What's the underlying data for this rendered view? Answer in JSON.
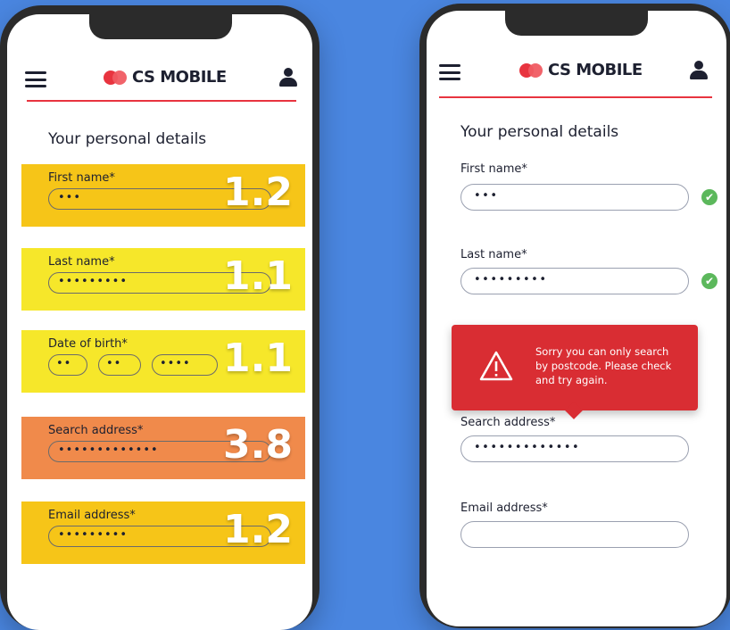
{
  "brand": {
    "name": "CS MOBILE"
  },
  "left_phone": {
    "section_title": "Your personal details",
    "fields": [
      {
        "label": "First name*",
        "masked": [
          "•••"
        ],
        "score": "1.2",
        "band_color": "#f6c518"
      },
      {
        "label": "Last name*",
        "masked": [
          "•••••••••"
        ],
        "score": "1.1",
        "band_color": "#f6e72a"
      },
      {
        "label": "Date of birth*",
        "masked": [
          "••",
          "••",
          "••••"
        ],
        "score": "1.1",
        "band_color": "#f6e72a"
      },
      {
        "label": "Search address*",
        "masked": [
          "•••••••••••••"
        ],
        "score": "3.8",
        "band_color": "#f08a4b"
      },
      {
        "label": "Email address*",
        "masked": [
          "•••••••••"
        ],
        "score": "1.2",
        "band_color": "#f6c518"
      }
    ]
  },
  "right_phone": {
    "section_title": "Your personal details",
    "fields": [
      {
        "label": "First name*",
        "value": "•••",
        "valid": true
      },
      {
        "label": "Last name*",
        "value": "•••••••••",
        "valid": true
      },
      {
        "label": "Search address*",
        "value": "•••••••••••••",
        "valid": false
      },
      {
        "label": "Email address*",
        "value": "",
        "valid": false
      }
    ],
    "error_tooltip": {
      "line1": "Sorry you can only search",
      "line2": "by postcode. Please check",
      "line3": "and try again."
    }
  },
  "colors": {
    "background": "#4a86e0",
    "brand_red": "#e8343f",
    "success": "#5cb85c",
    "error": "#d92d33"
  }
}
